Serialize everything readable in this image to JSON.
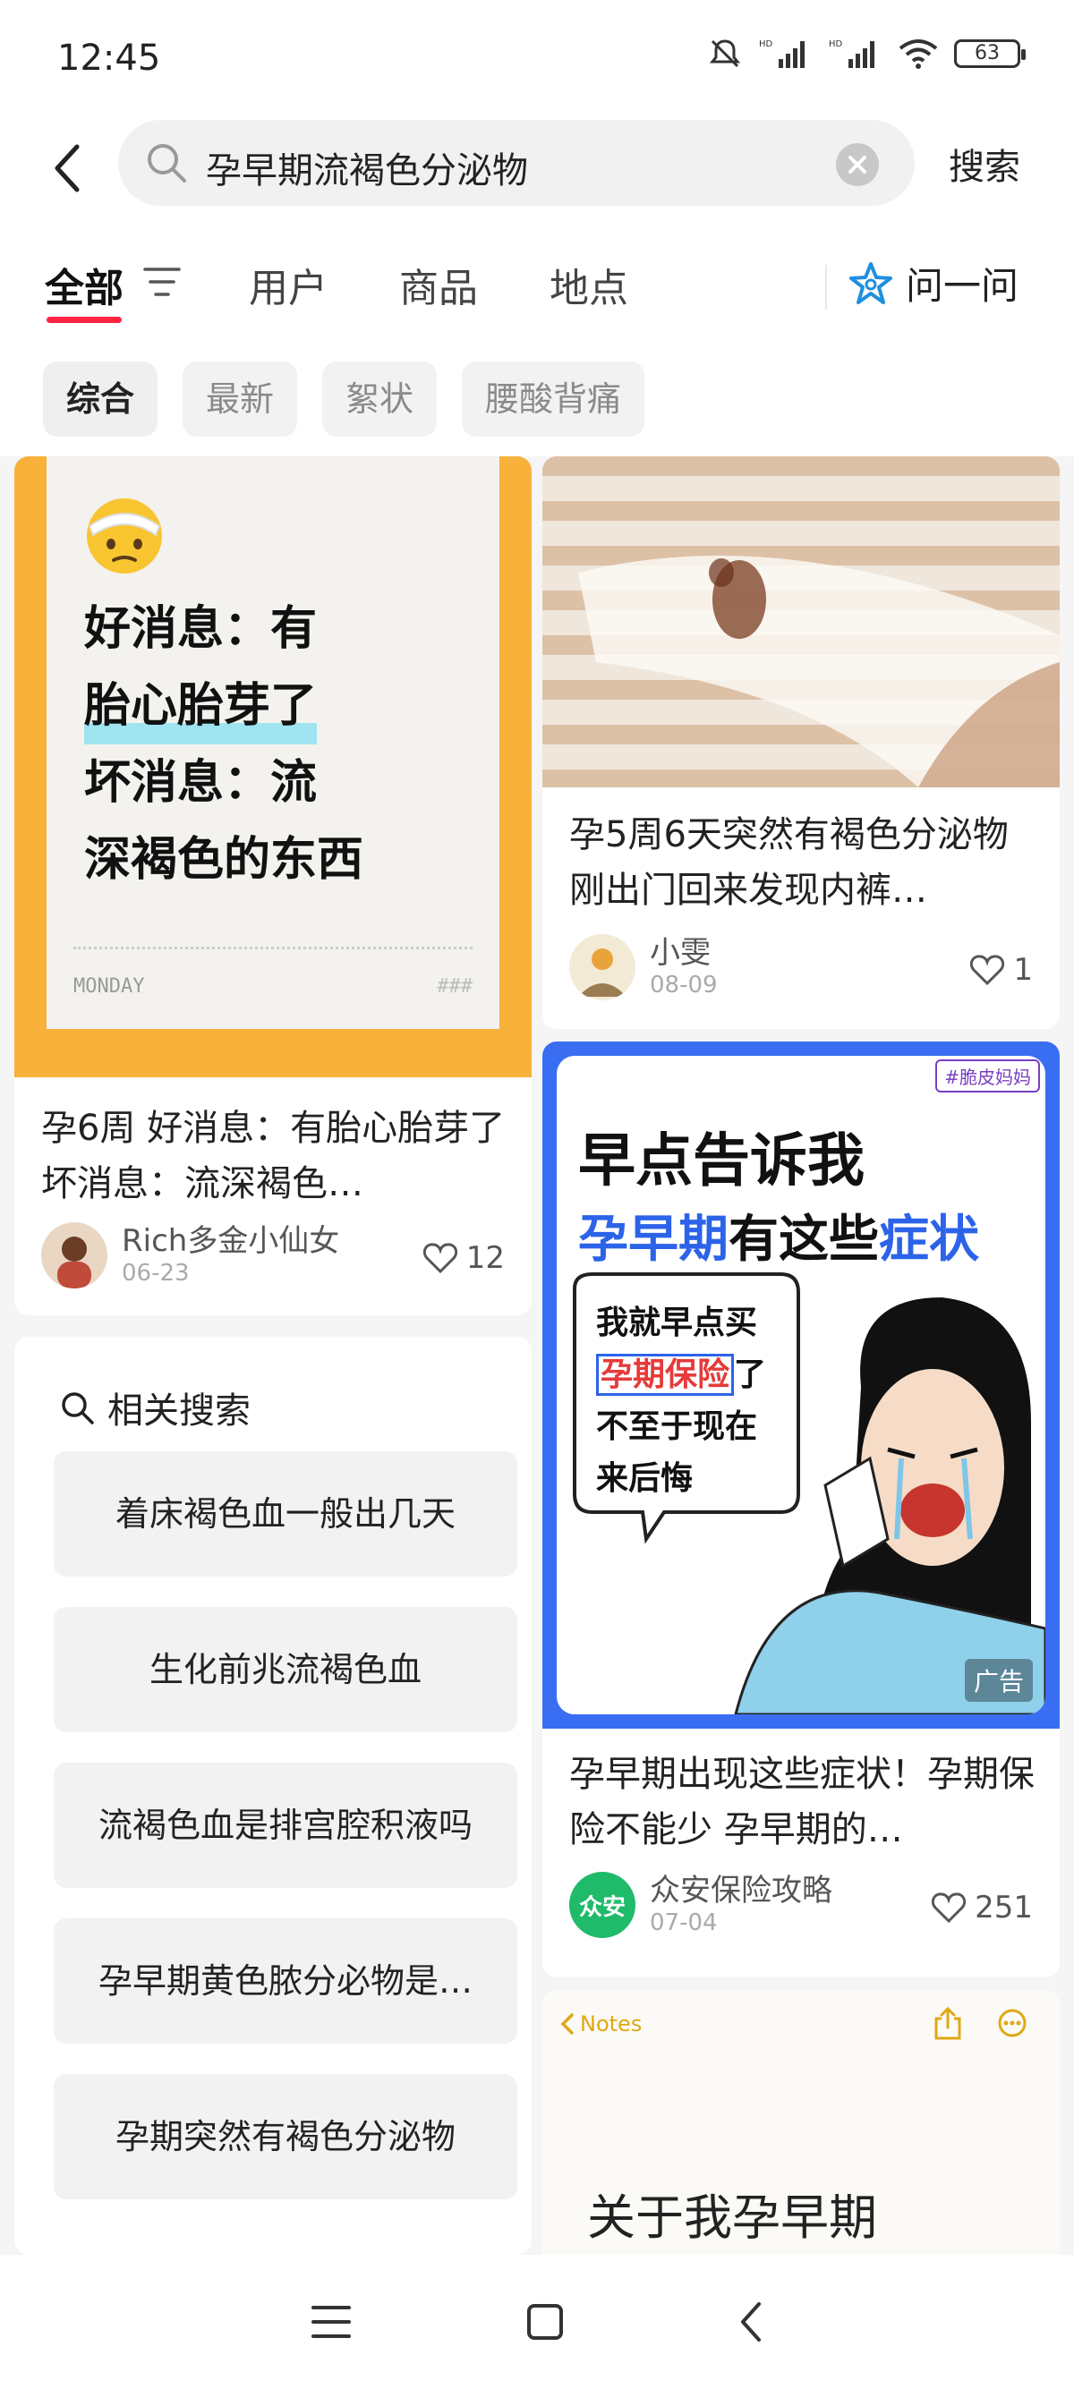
{
  "status_bar": {
    "time": "12:45",
    "battery": "63"
  },
  "search": {
    "query": "孕早期流褐色分泌物",
    "submit_label": "搜索"
  },
  "tabs": [
    {
      "label": "全部"
    },
    {
      "label": "用户"
    },
    {
      "label": "商品"
    },
    {
      "label": "地点"
    }
  ],
  "ask_label": "问一问",
  "chips": [
    "综合",
    "最新",
    "絮状",
    "腰酸背痛"
  ],
  "cards": [
    {
      "image_text": {
        "line1": "好消息：有",
        "line2": "胎心胎芽了",
        "line3": "坏消息：流",
        "line4": "深褐色的东西",
        "footer_left": "MONDAY",
        "footer_right": "###"
      },
      "title": "孕6周 好消息：有胎心胎芽了 坏消息：流深褐色…",
      "author": "Rich多金小仙女",
      "date": "06-23",
      "likes": "12"
    },
    {
      "title": "孕5周6天突然有褐色分泌物 刚出门回来发现内裤…",
      "author": "小雯",
      "date": "08-09",
      "likes": "1"
    },
    {
      "image_text": {
        "tag": "#脆皮妈妈",
        "headline1": "早点告诉我",
        "headline2_a": "孕早期",
        "headline2_b": "有这些",
        "headline2_c": "症状",
        "bubble1": "我就早点买",
        "bubble2_a": "孕期保险",
        "bubble2_b": "了",
        "bubble3": "不至于现在",
        "bubble4": "来后悔",
        "ad_badge": "广告"
      },
      "title": "孕早期出现这些症状！孕期保险不能少 孕早期的…",
      "author": "众安保险攻略",
      "author_avatar_text": "众安",
      "date": "07-04",
      "likes": "251"
    },
    {
      "notes_back": "Notes",
      "title": "关于我孕早期"
    }
  ],
  "related": {
    "title": "相关搜索",
    "items": [
      "着床褐色血一般出几天",
      "生化前兆流褐色血",
      "流褐色血是排宫腔积液吗",
      "孕早期黄色脓分必物是…",
      "孕期突然有褐色分泌物"
    ]
  },
  "colors": {
    "accent": "#ff2442",
    "card_orange": "#f8b13a",
    "ad_blue": "#3a6ef2"
  }
}
